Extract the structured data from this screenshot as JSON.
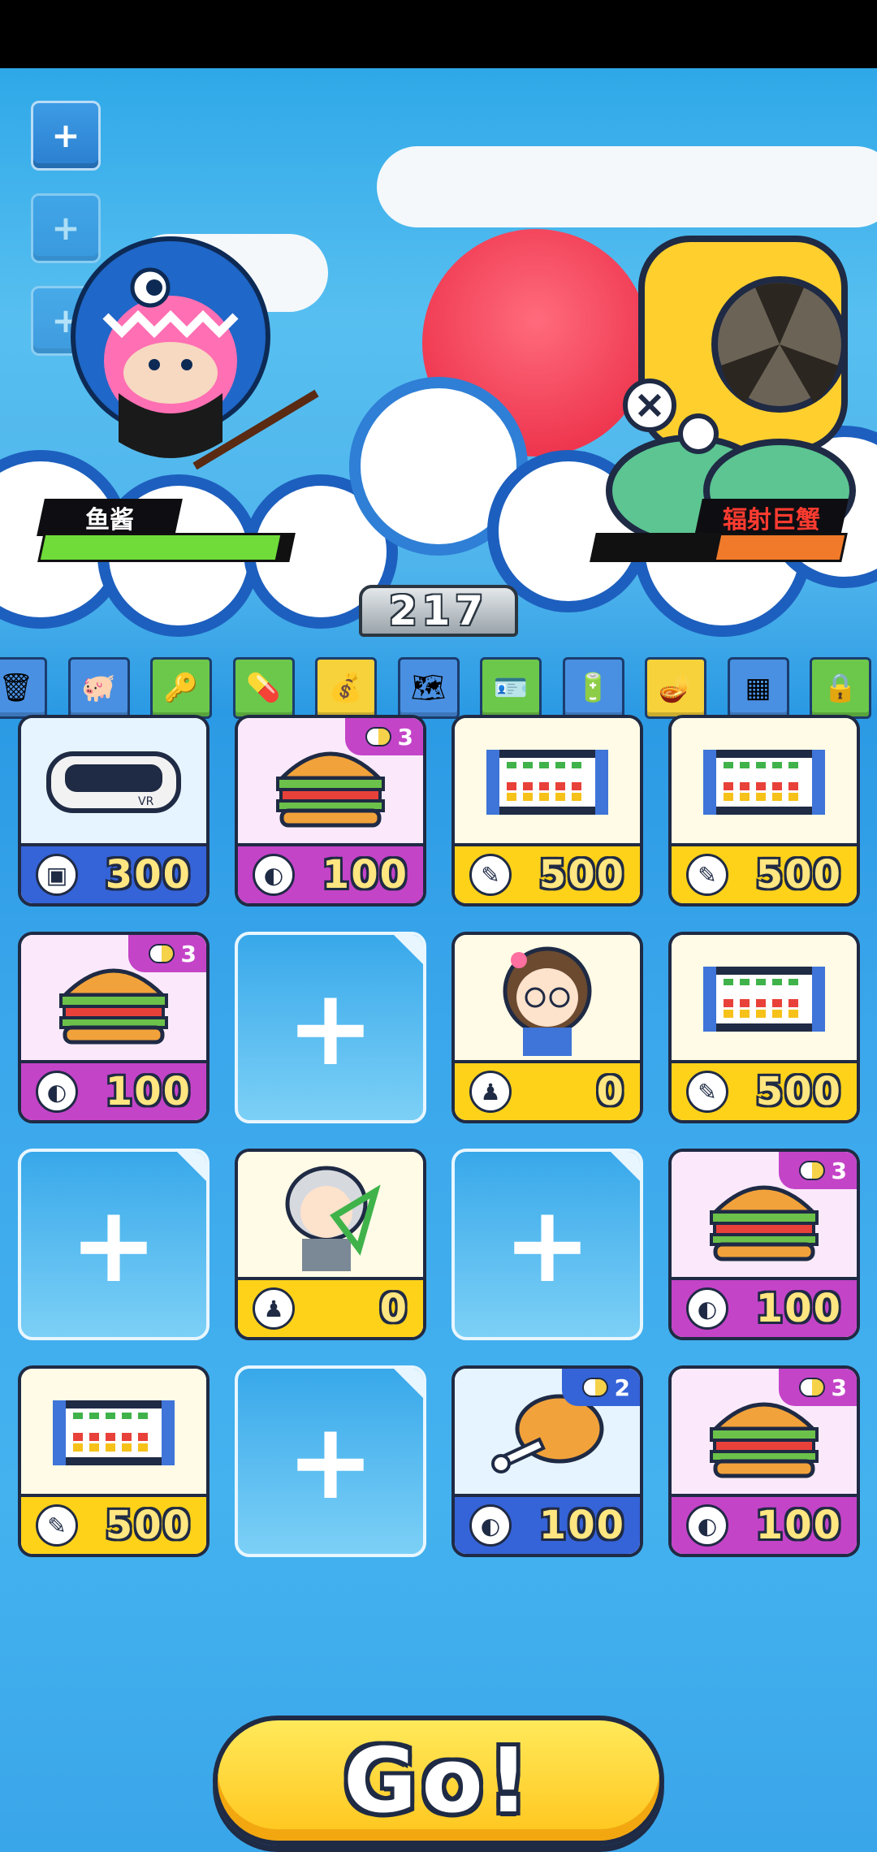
{
  "battle": {
    "player_name": "鱼酱",
    "player_hp_fraction": 0.95,
    "enemy_name": "辐射巨蟹",
    "enemy_hp_fraction": 0.5,
    "score": "217"
  },
  "side_buttons": [
    {
      "icon": "plus-icon",
      "state": "active"
    },
    {
      "icon": "plus-icon",
      "state": "dim"
    },
    {
      "icon": "plus-icon",
      "state": "dim"
    }
  ],
  "item_strip": [
    {
      "icon": "trash-can-icon",
      "color": "#4a90e2"
    },
    {
      "icon": "piggy-bank-icon",
      "color": "#4a90e2"
    },
    {
      "icon": "key-icon",
      "color": "#6cc84a"
    },
    {
      "icon": "pills-icon",
      "color": "#6cc84a"
    },
    {
      "icon": "money-bag-icon",
      "color": "#f7d23a"
    },
    {
      "icon": "treasure-map-icon",
      "color": "#4a90e2"
    },
    {
      "icon": "id-card-icon",
      "color": "#6cc84a"
    },
    {
      "icon": "battery-icon",
      "color": "#4a90e2"
    },
    {
      "icon": "magic-lamp-icon",
      "color": "#f7d23a"
    },
    {
      "icon": "net-icon",
      "color": "#4a90e2"
    },
    {
      "icon": "padlock-icon",
      "color": "#6cc84a"
    }
  ],
  "cards": [
    {
      "type": "item",
      "art": "vr-headset",
      "art_text": "VR",
      "price_icon": "chip-icon",
      "price": "300",
      "theme": "blue"
    },
    {
      "type": "item",
      "art": "burger",
      "price_icon": "bread-icon",
      "price": "100",
      "theme": "purple",
      "badge": "3"
    },
    {
      "type": "item",
      "art": "abacus",
      "price_icon": "bone-icon",
      "price": "500",
      "theme": "yellow"
    },
    {
      "type": "item",
      "art": "abacus",
      "price_icon": "bone-icon",
      "price": "500",
      "theme": "yellow"
    },
    {
      "type": "item",
      "art": "burger",
      "price_icon": "bread-icon",
      "price": "100",
      "theme": "purple",
      "badge": "3"
    },
    {
      "type": "empty"
    },
    {
      "type": "item",
      "art": "girl-portrait",
      "price_icon": "worker-icon",
      "price": "0",
      "theme": "yellow"
    },
    {
      "type": "item",
      "art": "abacus",
      "price_icon": "bone-icon",
      "price": "500",
      "theme": "yellow"
    },
    {
      "type": "empty"
    },
    {
      "type": "item",
      "art": "professor-portrait",
      "price_icon": "worker-icon",
      "price": "0",
      "theme": "yellow"
    },
    {
      "type": "empty"
    },
    {
      "type": "item",
      "art": "burger",
      "price_icon": "bread-icon",
      "price": "100",
      "theme": "purple",
      "badge": "3"
    },
    {
      "type": "item",
      "art": "abacus",
      "price_icon": "bone-icon",
      "price": "500",
      "theme": "yellow"
    },
    {
      "type": "empty"
    },
    {
      "type": "item",
      "art": "chicken-leg",
      "price_icon": "bread-icon",
      "price": "100",
      "theme": "blue",
      "badge": "2"
    },
    {
      "type": "item",
      "art": "burger",
      "price_icon": "bread-icon",
      "price": "100",
      "theme": "purple",
      "badge": "3"
    }
  ],
  "go_button": {
    "label": "Go!"
  },
  "colors": {
    "blue_price": "#3563d8",
    "purple_price": "#c444c8",
    "yellow_price": "#ffd21a",
    "player_hp": "#6fdc3a",
    "enemy_hp": "#f07a2a"
  }
}
